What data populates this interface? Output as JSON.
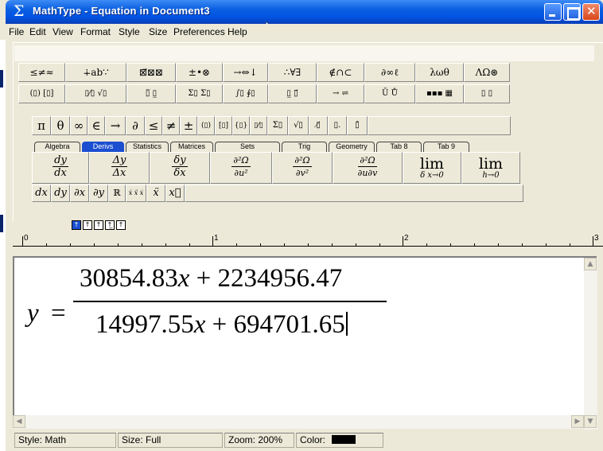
{
  "window": {
    "title": "MathType - Equation in Document3",
    "app_icon": "sigma-icon"
  },
  "menu": [
    "File",
    "Edit",
    "View",
    "Format",
    "Style",
    "Size",
    "Preferences",
    "Help"
  ],
  "palette_row1": [
    "≤≠≈",
    "∔ab∵",
    "⊠⃗⊠⊠",
    "±•⊗",
    "→⇔↓",
    "∴∀∃",
    "∉∩⊂",
    "∂∞ℓ",
    "λωθ",
    "ΛΩ⊛"
  ],
  "palette_row2": [
    "(▯) [▯]",
    "▯⁄▯ √▯",
    "▯̅ ▯̲",
    "Σ▯ Σ▯",
    "∫▯ ∮▯",
    "▯̲ ▯⃗",
    "→ ⇌",
    "Ū Ů",
    "▪▪▪ ▦",
    "▯ ▯"
  ],
  "palette_row3": [
    "π",
    "θ",
    "∞",
    "∈",
    "→",
    "∂",
    "≤",
    "≠",
    "±",
    "(▯)",
    "[▯]",
    "{▯}",
    "▯⁄▯",
    "Σ▯",
    "√▯",
    "▯̸",
    "▯.",
    "▯̄"
  ],
  "tabs": [
    "Algebra",
    "Derivs",
    "Statistics",
    "Matrices",
    "Sets",
    "Trig",
    "Geometry",
    "Tab 8",
    "Tab 9"
  ],
  "active_tab": "Derivs",
  "templates": [
    {
      "num": "dy",
      "den": "dx"
    },
    {
      "num": "Δy",
      "den": "Δx"
    },
    {
      "num": "δy",
      "den": "δx"
    },
    {
      "num": "∂²Ω",
      "den": "∂u²"
    },
    {
      "num": "∂²Ω",
      "den": "∂v²"
    },
    {
      "num": "∂²Ω",
      "den": "∂u∂v"
    },
    {
      "lim": "lim",
      "sub": "δ x→0"
    },
    {
      "lim": "lim",
      "sub": "h→0"
    }
  ],
  "row5": [
    "dx",
    "dy",
    "∂x",
    "∂y",
    "ℝ",
    "ẋ ẍ ẋ",
    "ẍ",
    "x⃛"
  ],
  "size_buttons": [
    "↑",
    "↑",
    "↑",
    "↑̲",
    "↑"
  ],
  "ruler_labels": [
    "0",
    "1",
    "2",
    "3"
  ],
  "equation": {
    "lhs": "y",
    "equals": "=",
    "numerator": {
      "a": "30854.83",
      "var": "x",
      "op": "+",
      "b": "2234956.47"
    },
    "denominator": {
      "a": "14997.55",
      "var": "x",
      "op": "+",
      "b": "694701.65"
    }
  },
  "status": {
    "style": "Style: Math",
    "size": "Size: Full",
    "zoom": "Zoom: 200%",
    "color": "Color:"
  }
}
